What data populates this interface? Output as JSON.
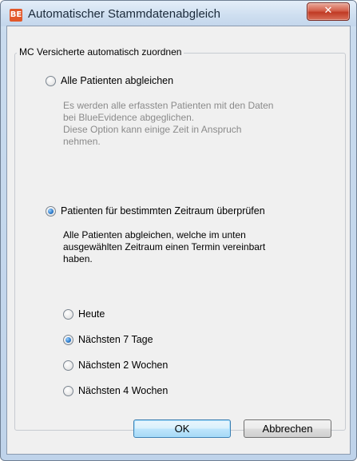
{
  "window": {
    "app_icon_text": "BE",
    "title": "Automatischer Stammdatenabgleich",
    "close_glyph": "✕"
  },
  "group": {
    "legend": "MC Versicherte automatisch zuordnen"
  },
  "options": {
    "all_patients": {
      "label": "Alle Patienten abgleichen",
      "selected": false,
      "description": "Es werden alle erfassten Patienten mit  den Daten\nbei BlueEvidence abgeglichen.\nDiese Option kann einige Zeit in Anspruch\nnehmen."
    },
    "period": {
      "label": "Patienten für bestimmten Zeitraum überprüfen",
      "selected": true,
      "description": "Alle Patienten abgleichen, welche im unten\nausgewählten Zeitraum einen Termin vereinbart\nhaben."
    }
  },
  "periods": [
    {
      "label": "Heute",
      "selected": false
    },
    {
      "label": "Nächsten 7 Tage",
      "selected": true
    },
    {
      "label": "Nächsten 2 Wochen",
      "selected": false
    },
    {
      "label": "Nächsten 4 Wochen",
      "selected": false
    }
  ],
  "buttons": {
    "ok": "OK",
    "cancel": "Abbrechen"
  }
}
